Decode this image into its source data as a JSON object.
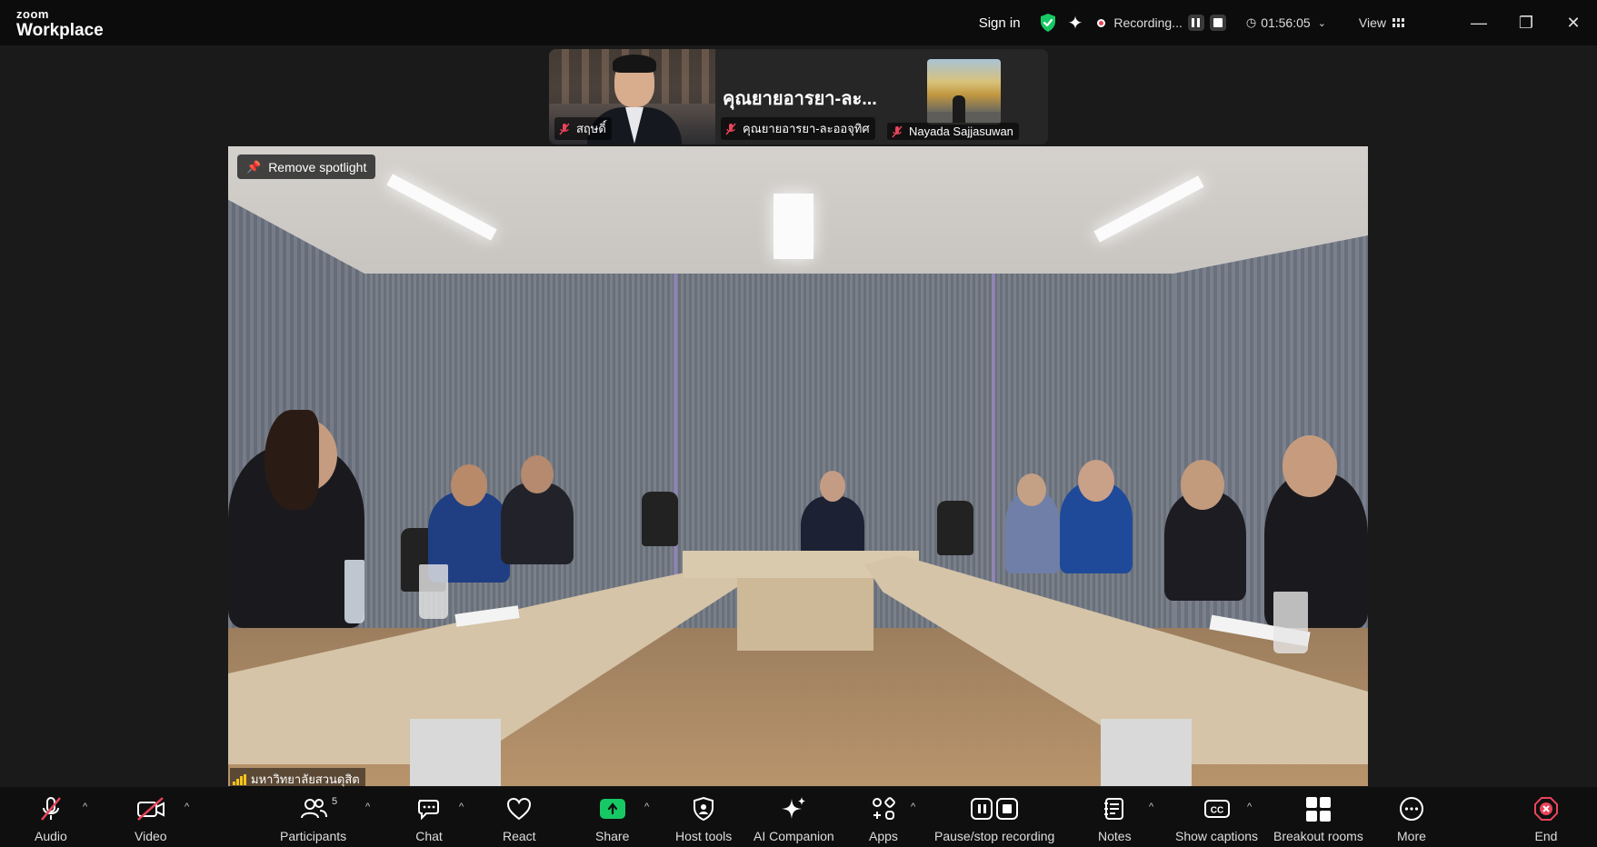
{
  "app": {
    "logo_top": "zoom",
    "logo_bottom": "Workplace"
  },
  "titlebar": {
    "signin": "Sign in",
    "recording_label": "Recording...",
    "timer": "01:56:05",
    "view_label": "View"
  },
  "thumbnails": [
    {
      "name": "สฤษดิ์",
      "muted": true
    },
    {
      "name": "คุณยายอารยา-ละออจุทิศ",
      "display_name": "คุณยายอารยา-ละ...",
      "muted": true
    },
    {
      "name": "Nayada Sajjasuwan",
      "muted": true
    }
  ],
  "main_video": {
    "spotlight_button": "Remove spotlight",
    "participant_name": "มหาวิทยาลัยสวนดุสิต"
  },
  "toolbar": {
    "audio": "Audio",
    "video": "Video",
    "participants": "Participants",
    "participants_count": "5",
    "chat": "Chat",
    "react": "React",
    "share": "Share",
    "host_tools": "Host tools",
    "ai_companion": "AI Companion",
    "apps": "Apps",
    "pause_stop_recording": "Pause/stop recording",
    "notes": "Notes",
    "show_captions": "Show captions",
    "breakout_rooms": "Breakout rooms",
    "more": "More",
    "end": "End"
  },
  "colors": {
    "share_green": "#17c964",
    "end_red": "#e9445a",
    "shield_green": "#17c964",
    "signal_yellow": "#f5c518"
  }
}
